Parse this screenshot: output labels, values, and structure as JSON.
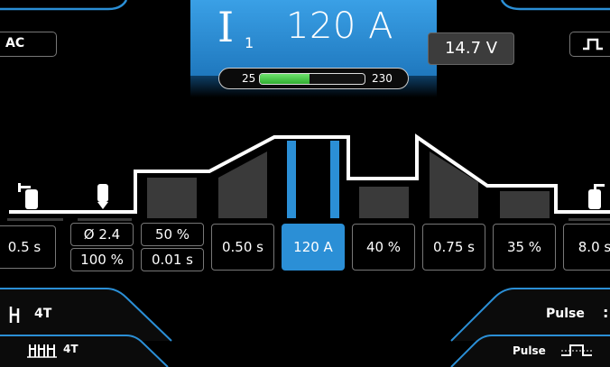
{
  "header": {
    "current_symbol": "I",
    "current_subscript": "1",
    "current_value": "120 A",
    "range_min": "25",
    "range_max": "230",
    "range_fill_fraction": 0.47,
    "voltage": "14.7 V",
    "mode_left": "AC",
    "mode_right_icon": "pulse-wave-icon"
  },
  "parameters": [
    {
      "label": "0.5 s"
    },
    {
      "top": "Ø 2.4",
      "bottom": "100 %"
    },
    {
      "top": "50 %",
      "bottom": "0.01 s"
    },
    {
      "label": "0.50 s"
    },
    {
      "label": "120 A",
      "active": true
    },
    {
      "label": "40 %"
    },
    {
      "label": "0.75 s"
    },
    {
      "label": "35 %"
    },
    {
      "label": "8.0 s"
    }
  ],
  "tabs": {
    "trigger_large": "4T",
    "trigger_small": "4T",
    "pulse_large": "Pulse",
    "pulse_small": "Pulse"
  },
  "colors": {
    "accent": "#2b8fd6",
    "range_fill": "#3fc43f",
    "waveform": "#ffffff",
    "stage_fill": "#3a3a3a"
  }
}
